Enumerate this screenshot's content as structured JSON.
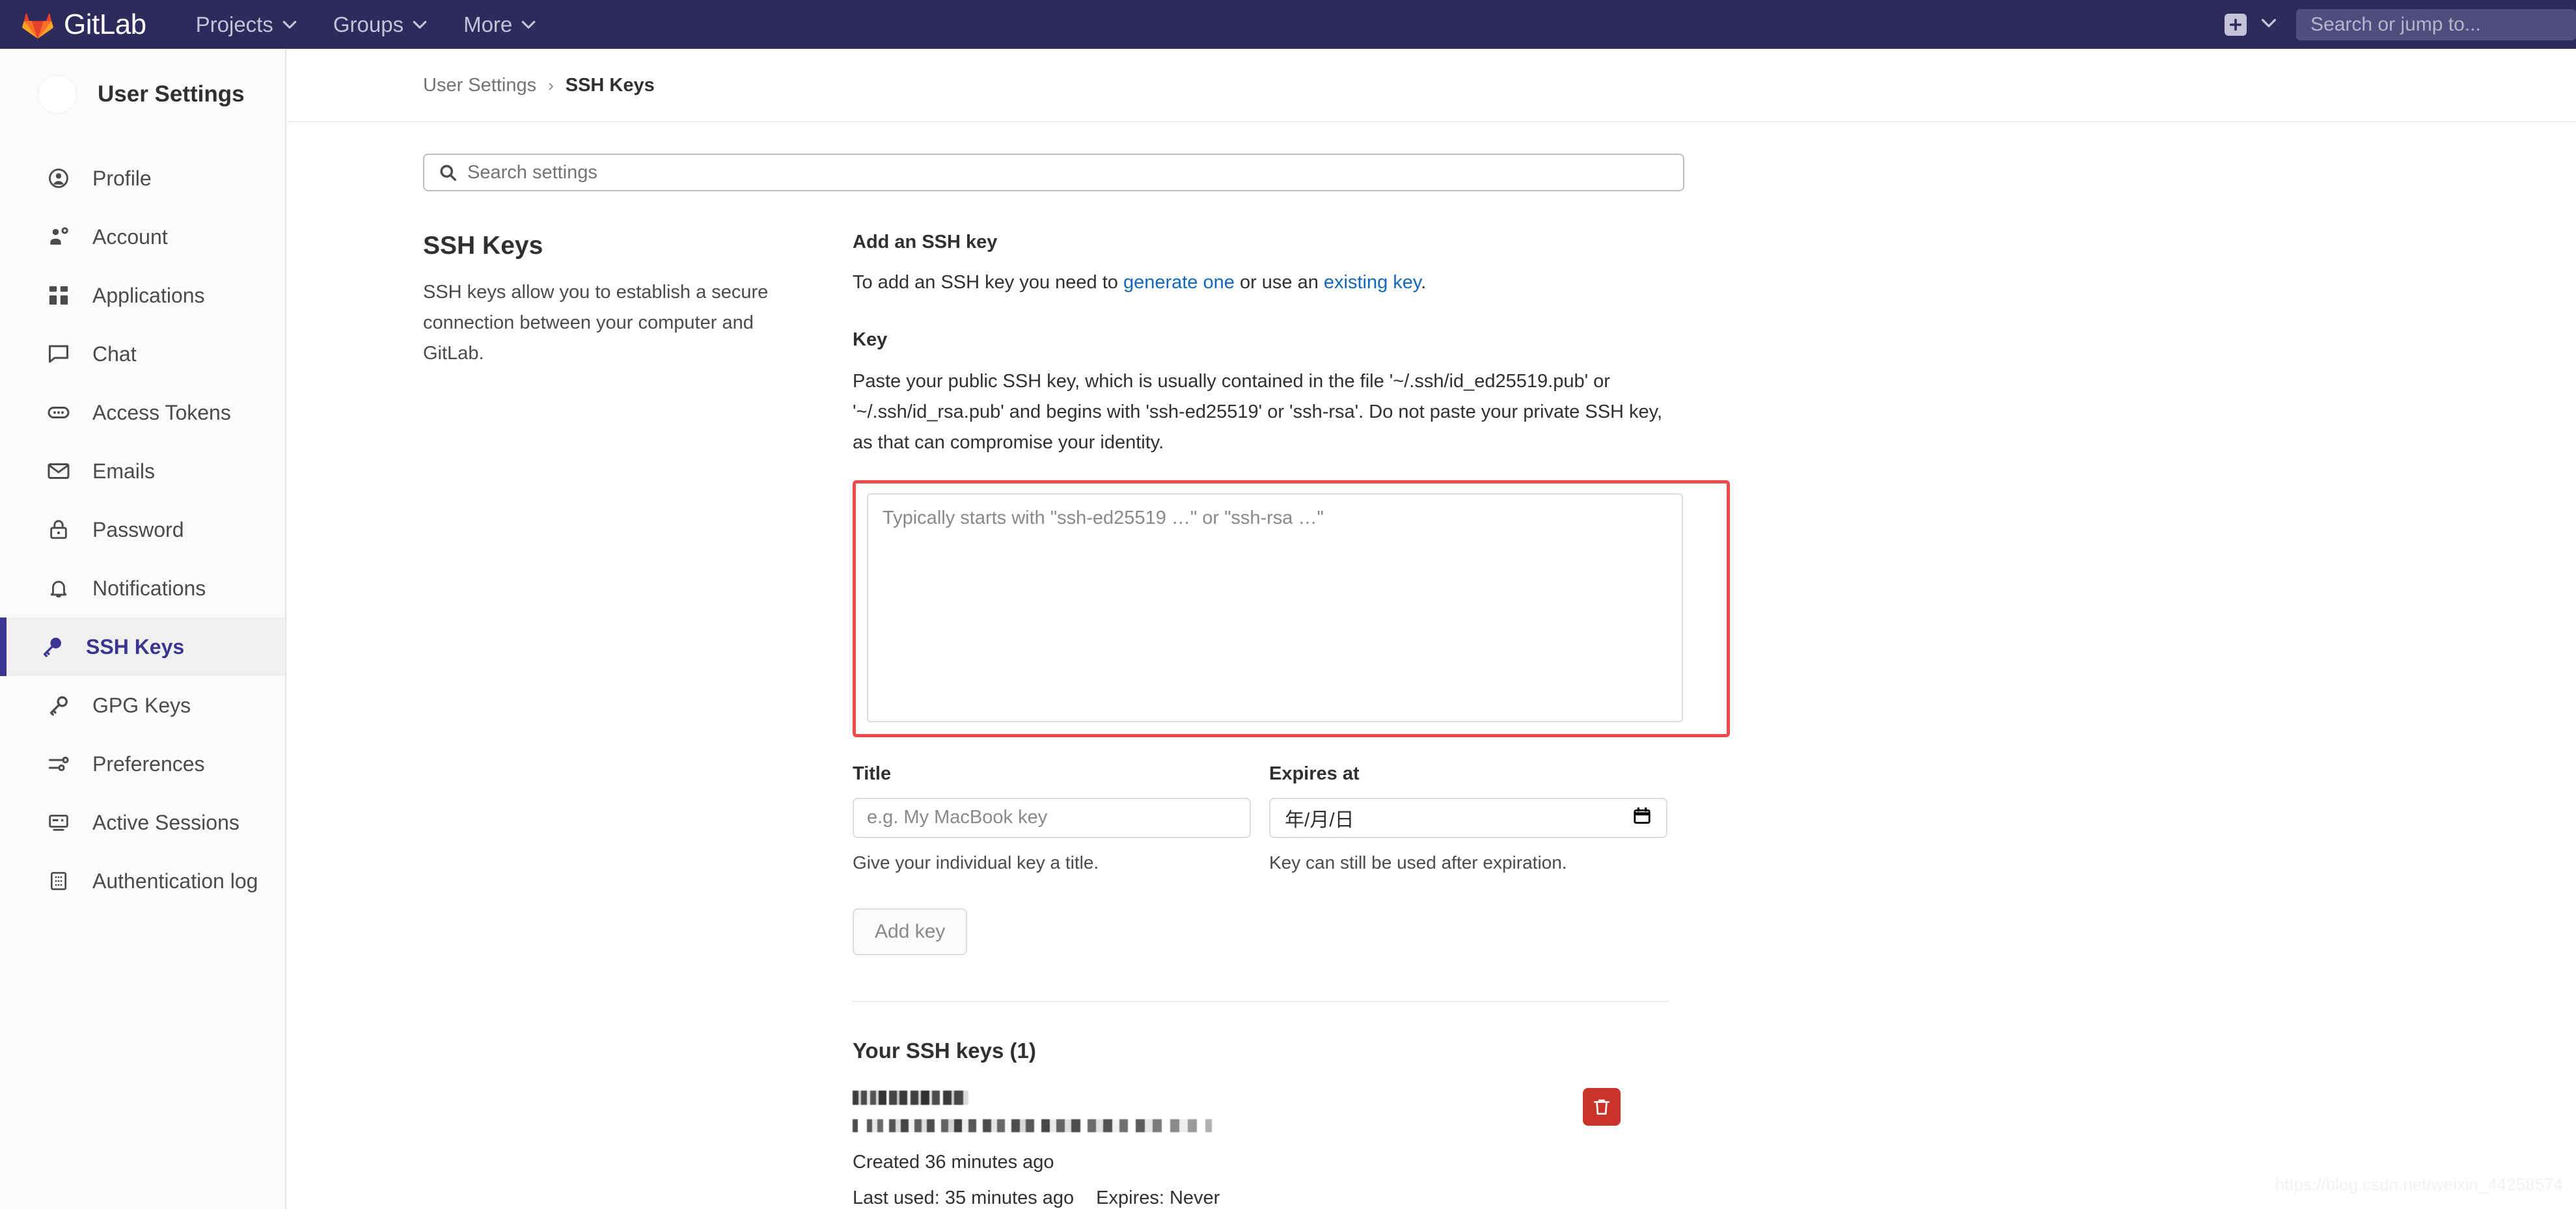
{
  "navbar": {
    "brand": "GitLab",
    "items": [
      {
        "label": "Projects",
        "icon": "chevron-down-icon"
      },
      {
        "label": "Groups",
        "icon": "chevron-down-icon"
      },
      {
        "label": "More",
        "icon": "chevron-down-icon"
      }
    ],
    "new_button_icon": "plus-square-icon",
    "new_button_caret_icon": "chevron-down-icon",
    "search_placeholder": "Search or jump to...",
    "background_color": "#2e2a5b"
  },
  "sidebar": {
    "title": "User Settings",
    "avatar": "user-avatar",
    "items": [
      {
        "label": "Profile",
        "icon": "user-circle-icon",
        "active": false
      },
      {
        "label": "Account",
        "icon": "user-gear-icon",
        "active": false
      },
      {
        "label": "Applications",
        "icon": "applications-grid-icon",
        "active": false
      },
      {
        "label": "Chat",
        "icon": "chat-bubble-icon",
        "active": false
      },
      {
        "label": "Access Tokens",
        "icon": "token-icon",
        "active": false
      },
      {
        "label": "Emails",
        "icon": "envelope-icon",
        "active": false
      },
      {
        "label": "Password",
        "icon": "lock-icon",
        "active": false
      },
      {
        "label": "Notifications",
        "icon": "bell-icon",
        "active": false
      },
      {
        "label": "SSH Keys",
        "icon": "key-icon",
        "active": true
      },
      {
        "label": "GPG Keys",
        "icon": "key-icon",
        "active": false
      },
      {
        "label": "Preferences",
        "icon": "sliders-icon",
        "active": false
      },
      {
        "label": "Active Sessions",
        "icon": "monitor-icon",
        "active": false
      },
      {
        "label": "Authentication log",
        "icon": "log-grid-icon",
        "active": false
      }
    ],
    "active_color": "#3a3591"
  },
  "breadcrumb": {
    "parent": "User Settings",
    "separator": "›",
    "current": "SSH Keys"
  },
  "search_settings": {
    "icon": "search-icon",
    "placeholder": "Search settings",
    "value": ""
  },
  "left_column": {
    "heading": "SSH Keys",
    "description": "SSH keys allow you to establish a secure connection between your computer and GitLab."
  },
  "add_key_section": {
    "heading": "Add an SSH key",
    "intro_prefix": "To add an SSH key you need to ",
    "intro_link_1": "generate one",
    "intro_middle": " or use an ",
    "intro_link_2": "existing key",
    "intro_suffix": ".",
    "key_label": "Key",
    "key_description": "Paste your public SSH key, which is usually contained in the file '~/.ssh/id_ed25519.pub' or '~/.ssh/id_rsa.pub' and begins with 'ssh-ed25519' or 'ssh-rsa'. Do not paste your private SSH key, as that can compromise your identity.",
    "key_textarea_placeholder": "Typically starts with \"ssh-ed25519 …\" or \"ssh-rsa …\"",
    "key_textarea_value": "",
    "highlight_color": "#ef4a4a",
    "title_label": "Title",
    "title_placeholder": "e.g. My MacBook key",
    "title_value": "",
    "title_help": "Give your individual key a title.",
    "expires_label": "Expires at",
    "expires_placeholder": "年/月/日",
    "expires_value": "",
    "expires_icon": "calendar-icon",
    "expires_help": "Key can still be used after expiration.",
    "submit_label": "Add key",
    "submit_disabled": true
  },
  "keys_list": {
    "heading": "Your SSH keys (1)",
    "rows": [
      {
        "title": "[redacted]",
        "fingerprint": "[redacted]",
        "created": "Created 36 minutes ago",
        "last_used": "Last used: 35 minutes ago",
        "expires": "Expires: Never",
        "delete_icon": "trash-icon",
        "delete_color": "#c9332a"
      }
    ]
  },
  "watermark": "https://blog.csdn.net/weixin_44258574"
}
